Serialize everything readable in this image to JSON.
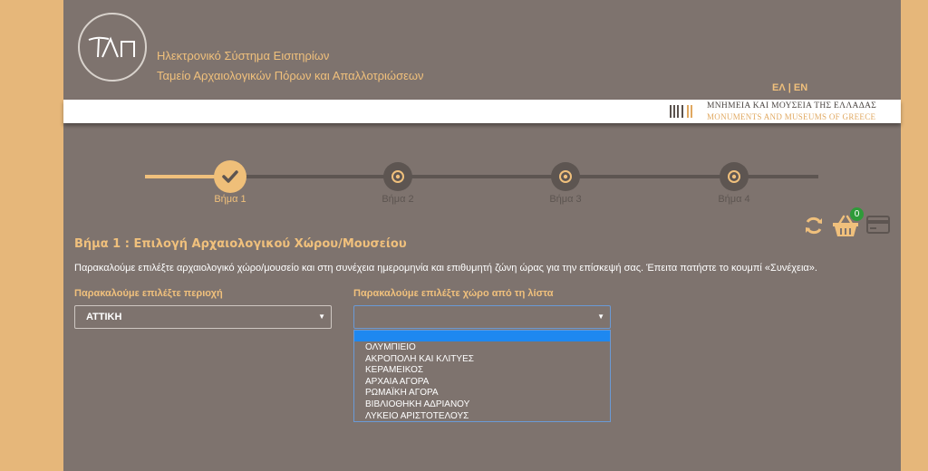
{
  "header": {
    "logo_text": "ΤΑΠ",
    "title_line1": "Ηλεκτρονικό Σύστημα Εισιτηρίων",
    "title_line2": "Ταμείο Αρχαιολογικών Πόρων και Απαλλοτριώσεων",
    "lang_el": "ΕΛ",
    "lang_sep": " | ",
    "lang_en": "EN"
  },
  "banner": {
    "greek": "ΜΝΗΜΕΙΑ ΚΑΙ ΜΟΥΣΕΙΑ ΤΗΣ ΕΛΛΑΔΑΣ",
    "english": "MONUMENTS AND MUSEUMS OF GREECE"
  },
  "stepper": {
    "steps": [
      {
        "label": "Βήμα 1",
        "state": "completed"
      },
      {
        "label": "Βήμα 2",
        "state": "pending"
      },
      {
        "label": "Βήμα 3",
        "state": "pending"
      },
      {
        "label": "Βήμα 4",
        "state": "pending"
      }
    ]
  },
  "toolbar": {
    "refresh_icon": "refresh-icon",
    "cart_icon": "basket-icon",
    "cart_count": "0",
    "card_icon": "credit-card-icon"
  },
  "main": {
    "section_title": "Βήμα 1 : Επιλογή Αρχαιολογικού Χώρου/Μουσείου",
    "instruction": "Παρακαλούμε επιλέξτε αρχαιολογικό χώρο/μουσείο και στη συνέχεια ημερομηνία και επιθυμητή ζώνη ώρας για την επίσκεψή σας. Έπειτα πατήστε το κουμπί «Συνέχεια».",
    "region_label": "Παρακαλούμε επιλέξτε περιοχή",
    "region_value": "ΑΤΤΙΚΗ",
    "site_label": "Παρακαλούμε επιλέξτε χώρο από τη λίστα",
    "site_value": "",
    "site_options": [
      "ΟΛΥΜΠΙΕΙΟ",
      "ΑΚΡΟΠΟΛΗ ΚΑΙ ΚΛΙΤΥΕΣ",
      "ΚΕΡΑΜΕΙΚΟΣ",
      "ΑΡΧΑΙΑ ΑΓΟΡΑ",
      "ΡΩΜΑΪΚΗ ΑΓΟΡΑ",
      "ΒΙΒΛΙΟΘΗΚΗ ΑΔΡΙΑΝΟΥ",
      "ΛΥΚΕΙΟ ΑΡΙΣΤΟΤΕΛΟΥΣ"
    ]
  },
  "colors": {
    "accent": "#f0c07c",
    "page_bg": "#7e736e",
    "outer_bg": "#e6b77a",
    "highlight": "#1e88f0",
    "badge": "#2e9b39"
  }
}
